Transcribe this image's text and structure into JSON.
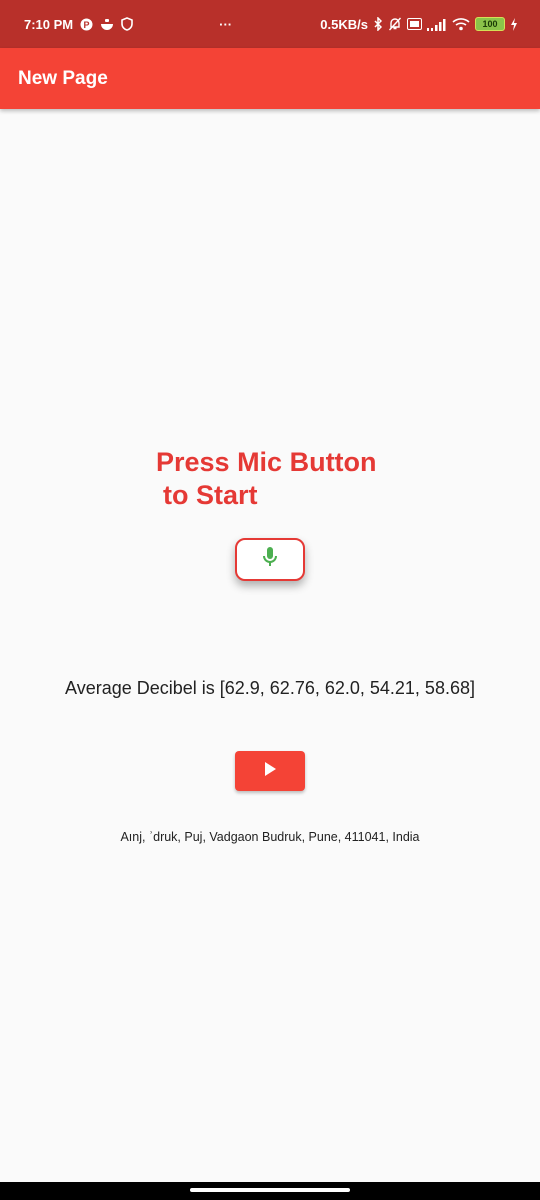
{
  "status_bar": {
    "time": "7:10 PM",
    "overflow": "···",
    "network_speed": "0.5KB/s",
    "battery": "100",
    "icons": [
      "p-badge-icon",
      "bowl-icon",
      "shield-icon",
      "bluetooth-icon",
      "bell-off-icon",
      "volte-icon",
      "signal-icon",
      "wifi-icon",
      "battery-icon",
      "charging-icon"
    ]
  },
  "app_bar": {
    "title": "New Page"
  },
  "main": {
    "prompt_line1": "Press Mic Button",
    "prompt_line2": "to Start",
    "mic_icon": "mic-icon",
    "decibel_text": "Average Decibel is [62.9, 62.76, 62.0, 54.21, 58.68]",
    "play_icon": "play-icon",
    "address": "Aınj, ʾdruk, Puj, Vadgaon Budruk, Pune, 411041, India"
  },
  "colors": {
    "status_bar": "#b8302a",
    "app_bar": "#f44336",
    "accent_red": "#e53935",
    "mic_green": "#4caf50",
    "background": "#fafafa"
  }
}
